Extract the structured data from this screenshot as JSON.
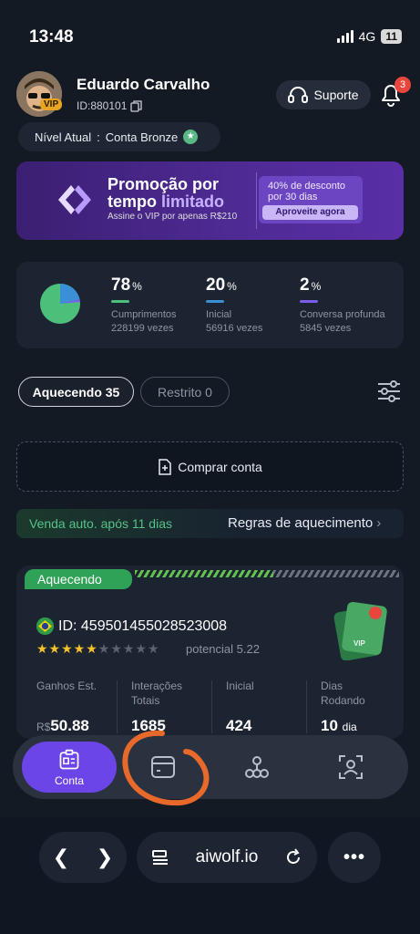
{
  "status_bar": {
    "time": "13:48",
    "network": "4G",
    "battery": "11"
  },
  "profile": {
    "name": "Eduardo Carvalho",
    "id": "ID:880101",
    "vip_badge": "VIP",
    "level_label": "Nível Atual",
    "level_value": "Conta Bronze"
  },
  "header": {
    "support_label": "Suporte",
    "notification_count": "3"
  },
  "banner": {
    "title_line1": "Promoção por",
    "title_line2a": "tempo ",
    "title_line2b": "limitado",
    "subtitle": "Assine o VIP por apenas R$210",
    "discount_line1": "40% de desconto",
    "discount_line2": "por 30 dias",
    "cta": "Aproveite agora"
  },
  "stats": [
    {
      "pct": "78",
      "label": "Cumprimentos",
      "count": "228199 vezes",
      "color": "#4cc07b"
    },
    {
      "pct": "20",
      "label": "Inicial",
      "count": "56916 vezes",
      "color": "#3a8fd6"
    },
    {
      "pct": "2",
      "label": "Conversa profunda",
      "count": "5845 vezes",
      "color": "#7b5cf0"
    }
  ],
  "tabs": {
    "warming": "Aquecendo 35",
    "restricted": "Restrito 0"
  },
  "buy_account": "Comprar conta",
  "auto_sale": {
    "left": "Venda auto. após 11 dias",
    "right": "Regras de aquecimento"
  },
  "account": {
    "status_tag": "Aquecendo",
    "id": "ID: 459501455028523008",
    "rating": 5.22,
    "rating_stars_filled": 5,
    "rating_stars_total": 10,
    "potential_label": "potencial 5.22",
    "columns": [
      {
        "label": "Ganhos Est.",
        "currency": "R$",
        "value": "50.88",
        "unit": ""
      },
      {
        "label": "Interações Totais",
        "currency": "",
        "value": "1685",
        "unit": ""
      },
      {
        "label": "Inicial",
        "currency": "",
        "value": "424",
        "unit": ""
      },
      {
        "label": "Dias Rodando",
        "currency": "",
        "value": "10",
        "unit": "dia"
      }
    ]
  },
  "bottom_nav": {
    "active_label": "Conta"
  },
  "browser": {
    "url": "aiwolf.io"
  },
  "colors": {
    "accent": "#6c45e8",
    "green": "#2fa257",
    "annotation": "#e8692a"
  }
}
